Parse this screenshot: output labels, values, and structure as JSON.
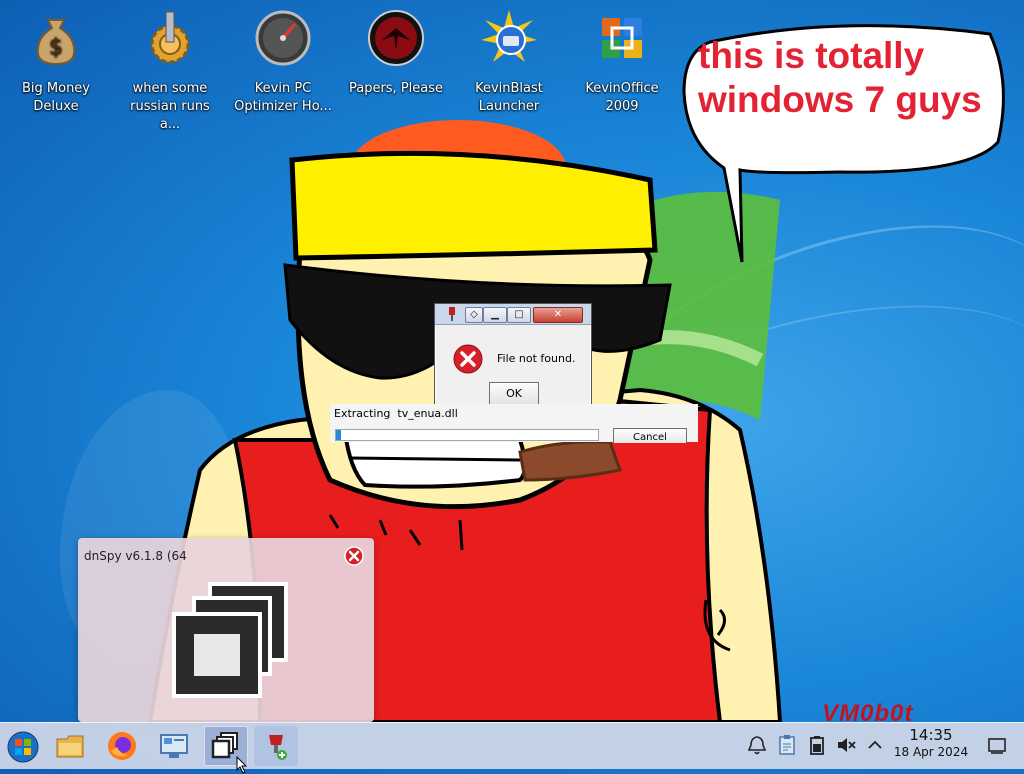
{
  "desktop_icons": [
    {
      "name": "Big Money Deluxe",
      "line1": "Big Money",
      "line2": "Deluxe",
      "icon": "money-bag-icon"
    },
    {
      "name": "when some russian runs a...",
      "line1": "when some",
      "line2": "russian runs a...",
      "icon": "gear-icon"
    },
    {
      "name": "Kevin PC Optimizer Ho...",
      "line1": "Kevin PC",
      "line2": "Optimizer Ho...",
      "icon": "speedometer-icon"
    },
    {
      "name": "Papers, Please",
      "line1": "Papers, Please",
      "line2": "",
      "icon": "papers-please-icon"
    },
    {
      "name": "KevinBlast Launcher",
      "line1": "KevinBlast",
      "line2": "Launcher",
      "icon": "sun-launcher-icon"
    },
    {
      "name": "KevinOffice 2009",
      "line1": "KevinOffice",
      "line2": "2009",
      "icon": "office-logo-icon"
    }
  ],
  "speech_bubble": {
    "line1": "this is totally",
    "line2": "windows 7 guys"
  },
  "error_dialog": {
    "message": "File not found.",
    "ok_label": "OK"
  },
  "extract_dialog": {
    "label": "Extracting  tv_enua.dll",
    "progress": 0.02,
    "cancel_label": "Cancel"
  },
  "task_preview": {
    "title": "dnSpy v6.1.8 (64"
  },
  "watermark": "VM0b0t",
  "taskbar": {
    "items": [
      "start-orb-icon",
      "file-explorer-icon",
      "firefox-icon",
      "control-panel-icon",
      "task-view-icon",
      "installer-icon"
    ],
    "tray": [
      "notifications-bell-icon",
      "clipboard-icon",
      "battery-icon",
      "volume-muted-icon",
      "chevron-up-icon",
      "show-desktop-icon"
    ]
  },
  "clock": {
    "time": "14:35",
    "date": "18 Apr 2024"
  },
  "colors": {
    "bubble_text": "#e32233",
    "watermark": "#c4131f",
    "accent": "#2a86d8"
  }
}
